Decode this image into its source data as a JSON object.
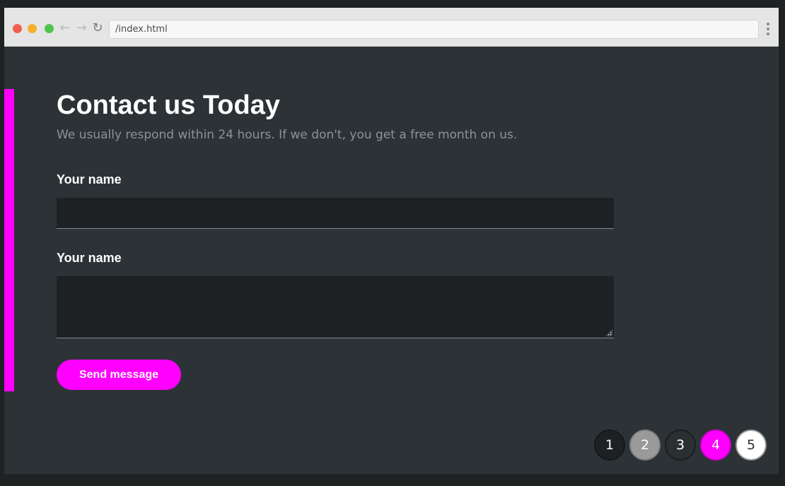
{
  "browser": {
    "url": "/index.html",
    "back_glyph": "←",
    "forward_glyph": "→",
    "reload_glyph": "↻"
  },
  "page": {
    "title": "Contact us Today",
    "subtitle": "We usually respond within 24 hours. If we don't, you get a free month on us.",
    "field1_label": "Your name",
    "field1_value": "",
    "field2_label": "Your name",
    "field2_value": "",
    "send_label": "Send message",
    "accent_color": "#ff00ff"
  },
  "pagination": {
    "pages": [
      {
        "label": "1",
        "state": "dark"
      },
      {
        "label": "2",
        "state": "gray"
      },
      {
        "label": "3",
        "state": "default"
      },
      {
        "label": "4",
        "state": "active"
      },
      {
        "label": "5",
        "state": "light"
      }
    ]
  }
}
